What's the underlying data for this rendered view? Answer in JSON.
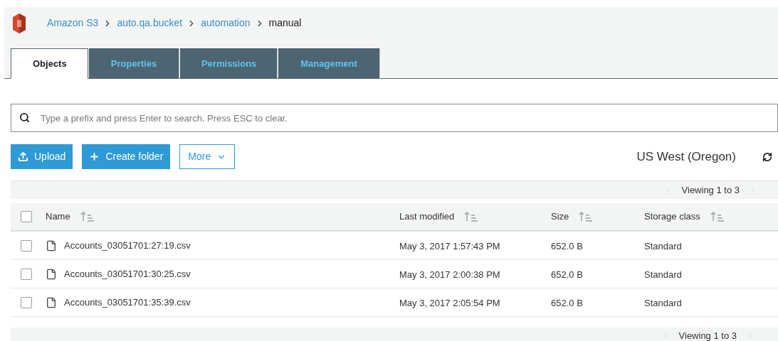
{
  "breadcrumb": [
    {
      "label": "Amazon S3",
      "kind": "link"
    },
    {
      "label": "auto.qa.bucket",
      "kind": "link"
    },
    {
      "label": "automation",
      "kind": "link"
    },
    {
      "label": "manual",
      "kind": "current"
    }
  ],
  "tabs": [
    {
      "label": "Objects",
      "selected": true
    },
    {
      "label": "Properties",
      "selected": false
    },
    {
      "label": "Permissions",
      "selected": false
    },
    {
      "label": "Management",
      "selected": false
    }
  ],
  "search": {
    "placeholder": "Type a prefix and press Enter to search. Press ESC to clear."
  },
  "actions": [
    {
      "label": "Upload",
      "kind": "upload"
    },
    {
      "label": "Create folder",
      "kind": "create"
    },
    {
      "label": "More",
      "kind": "more"
    }
  ],
  "region": "US West (Oregon)",
  "pager_top": "Viewing 1 to 3",
  "table": {
    "columns": [
      "Name",
      "Last modified",
      "Size",
      "Storage class"
    ],
    "all_checked": false,
    "rows": [
      {
        "checked": false,
        "name": "Accounts_03051701:27:19.csv",
        "modified": "May 3, 2017 1:57:43 PM",
        "size": "652.0 B",
        "storage": "Standard"
      },
      {
        "checked": false,
        "name": "Accounts_03051701:30:25.csv",
        "modified": "May 3, 2017 2:00:38 PM",
        "size": "652.0 B",
        "storage": "Standard"
      },
      {
        "checked": false,
        "name": "Accounts_03051701:35:39.csv",
        "modified": "May 3, 2017 2:05:54 PM",
        "size": "652.0 B",
        "storage": "Standard"
      }
    ]
  },
  "pager_bottom": "Viewing 1 to 3"
}
